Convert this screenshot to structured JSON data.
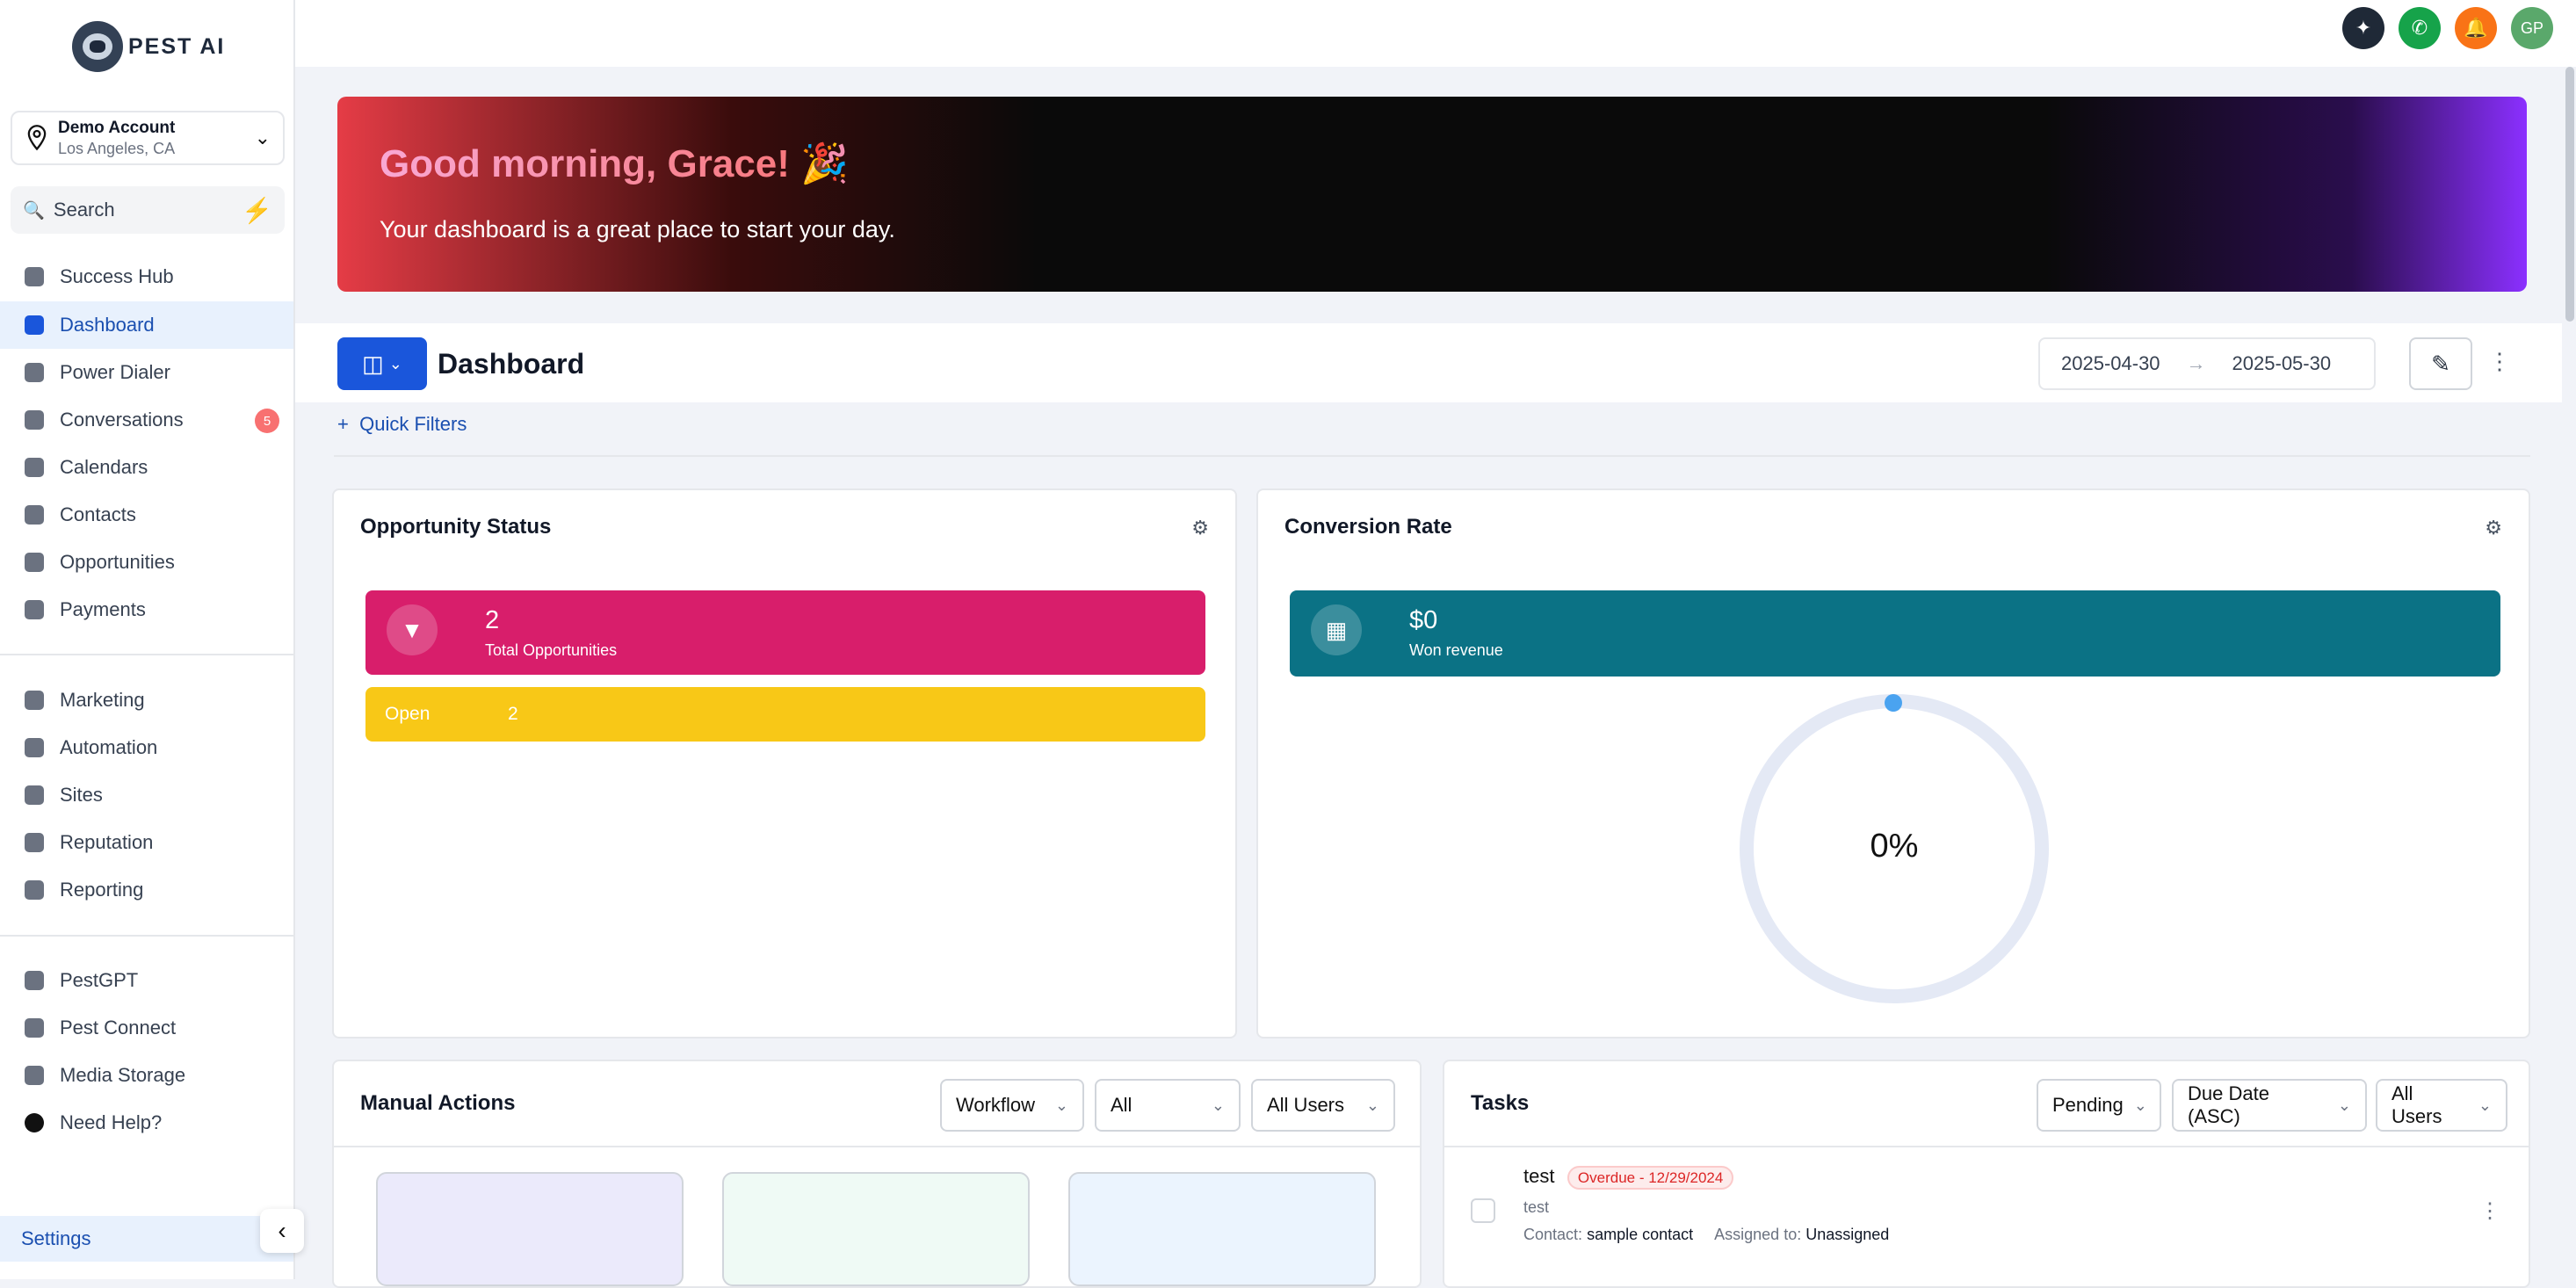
{
  "brand": {
    "name": "PEST AI"
  },
  "account": {
    "name": "Demo Account",
    "location": "Los Angeles, CA"
  },
  "search": {
    "placeholder": "Search"
  },
  "nav": {
    "primary": [
      {
        "label": "Success Hub",
        "icon": "medal-icon"
      },
      {
        "label": "Dashboard",
        "icon": "grid-icon",
        "active": true
      },
      {
        "label": "Power Dialer",
        "icon": "phone-icon"
      },
      {
        "label": "Conversations",
        "icon": "chat-icon",
        "badge": "5"
      },
      {
        "label": "Calendars",
        "icon": "calendar-icon"
      },
      {
        "label": "Contacts",
        "icon": "user-icon"
      },
      {
        "label": "Opportunities",
        "icon": "funnel-icon"
      },
      {
        "label": "Payments",
        "icon": "card-icon"
      }
    ],
    "secondary": [
      {
        "label": "Marketing",
        "icon": "megaphone-icon"
      },
      {
        "label": "Automation",
        "icon": "gear-icon"
      },
      {
        "label": "Sites",
        "icon": "sites-icon"
      },
      {
        "label": "Reputation",
        "icon": "star-icon"
      },
      {
        "label": "Reporting",
        "icon": "pie-icon"
      }
    ],
    "tertiary": [
      {
        "label": "PestGPT",
        "icon": "bot-icon"
      },
      {
        "label": "Pest Connect",
        "icon": "connect-icon"
      },
      {
        "label": "Media Storage",
        "icon": "image-icon"
      },
      {
        "label": "Need Help?",
        "icon": "help-icon"
      }
    ],
    "settings": "Settings"
  },
  "topbar": {
    "avatar": "GP"
  },
  "hero": {
    "greeting": "Good morning, Grace!",
    "emoji": "🎉",
    "subtitle": "Your dashboard is a great place to start your day."
  },
  "dashboard": {
    "title": "Dashboard",
    "date_from": "2025-04-30",
    "date_to": "2025-05-30",
    "quick_filters": "Quick Filters"
  },
  "opportunity_status": {
    "title": "Opportunity Status",
    "total_value": "2",
    "total_label": "Total Opportunities",
    "open_label": "Open",
    "open_value": "2"
  },
  "conversion_rate": {
    "title": "Conversion Rate",
    "won_value": "$0",
    "won_label": "Won revenue",
    "rate": "0%"
  },
  "manual_actions": {
    "title": "Manual Actions",
    "filter_type": "Workflow",
    "filter_status": "All",
    "filter_users": "All Users"
  },
  "tasks": {
    "title": "Tasks",
    "filter_status": "Pending",
    "filter_sort": "Due Date (ASC)",
    "filter_users": "All Users",
    "items": [
      {
        "title": "test",
        "due": "Overdue - 12/29/2024",
        "body": "test",
        "contact_label": "Contact:",
        "contact": "sample contact",
        "assigned_label": "Assigned to:",
        "assigned": "Unassigned"
      }
    ]
  },
  "colors": {
    "accent": "#1a56db",
    "pink": "#d81e6b",
    "yellow": "#f8c817",
    "teal": "#0b7285"
  }
}
